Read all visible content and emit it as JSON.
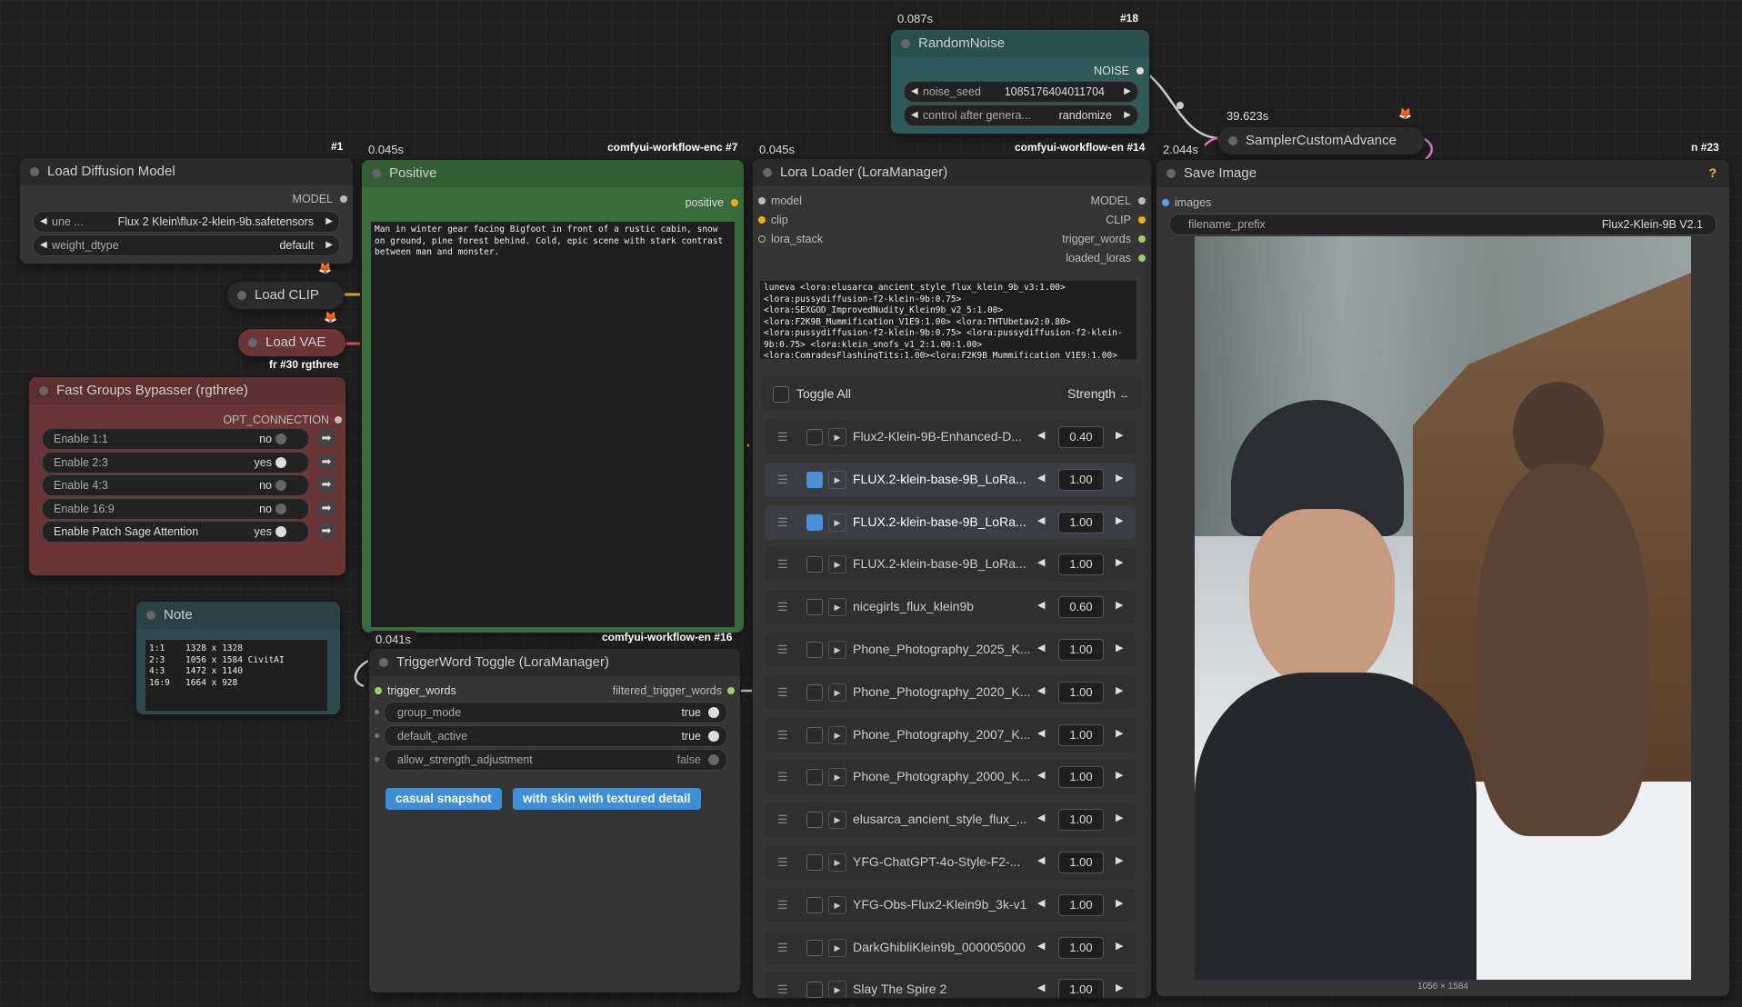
{
  "colors": {
    "positive_green": "#3a6b3a",
    "noise_teal": "#2f5a5a",
    "vae_red": "#6b3535",
    "bypasser_red": "#6b3535",
    "note_teal": "#2f4a4f",
    "accent_blue": "#3c8fd8"
  },
  "timings": {
    "t_random": "0.087s",
    "t_positive": "0.045s",
    "t_lora": "0.045s",
    "t_sampler": "39.623s",
    "t_save": "2.044s",
    "t_trigger": "0.041s"
  },
  "ids": {
    "id_random": "#18",
    "id_load_diff": "#1",
    "id_positive": "comfyui-workflow-enc #7",
    "id_lora": "comfyui-workflow-en #14",
    "id_save": "#23",
    "id_bypasser": "#30 rgthree",
    "id_trigger": "comfyui-workflow-en #16"
  },
  "load_diffusion": {
    "title": "Load Diffusion Model",
    "out": "MODEL",
    "unet_prefix": "une ...",
    "unet_value": "Flux 2 Klein\\flux-2-klein-9b.safetensors",
    "dtype_label": "weight_dtype",
    "dtype_value": "default"
  },
  "load_clip": {
    "title": "Load CLIP"
  },
  "load_vae": {
    "title": "Load VAE"
  },
  "bypasser": {
    "title": "Fast Groups Bypasser (rgthree)",
    "out": "OPT_CONNECTION",
    "rows": [
      {
        "label": "Enable 1:1",
        "value": "no",
        "on": false
      },
      {
        "label": "Enable 2:3",
        "value": "yes",
        "on": true
      },
      {
        "label": "Enable 4:3",
        "value": "no",
        "on": false
      },
      {
        "label": "Enable 16:9",
        "value": "no",
        "on": false
      },
      {
        "label": "Enable Patch Sage Attention",
        "value": "yes",
        "on": true
      }
    ]
  },
  "note": {
    "title": "Note",
    "text": "1:1    1328 x 1328\n2:3    1056 x 1584 CivitAI\n4:3    1472 x 1140\n16:9   1664 x 928"
  },
  "positive": {
    "title": "Positive",
    "out": "positive",
    "prompt": "Man in winter gear facing Bigfoot in front of a rustic cabin, snow on ground, pine forest behind. Cold, epic scene with stark contrast between man and monster."
  },
  "random_noise": {
    "title": "RandomNoise",
    "out": "NOISE",
    "seed_label": "noise_seed",
    "seed_value": "1085176404011704",
    "ctrl_label": "control after genera...",
    "ctrl_value": "randomize"
  },
  "sampler": {
    "title": "SamplerCustomAdvance"
  },
  "lora_loader": {
    "title": "Lora Loader (LoraManager)",
    "in_model": "model",
    "in_clip": "clip",
    "in_stack": "lora_stack",
    "out_model": "MODEL",
    "out_clip": "CLIP",
    "out_trigger": "trigger_words",
    "out_loaded": "loaded_loras",
    "text": "luneva <lora:elusarca_ancient_style_flux_klein_9b_v3:1.00>\n<lora:pussydiffusion-f2-klein-9b:0.75>\n<lora:SEXGOD_ImprovedNudity_Klein9b_v2_5:1.00>\n<lora:F2K9B_Mummification_V1E9:1.00> <lora:THTUbetav2:0.80>\n<lora:pussydiffusion-f2-klein-9b:0.75> <lora:pussydiffusion-f2-klein-9b:0.75> <lora:klein_snofs_v1_2:1.00:1.00>\n<lora:ComradesFlashingTits:1.00><lora:F2K9B_Mummification_V1E9:1.00>",
    "toggle_all": "Toggle All",
    "strength_header": "Strength",
    "rows": [
      {
        "name": "Flux2-Klein-9B-Enhanced-D...",
        "strength": "0.40",
        "on": false,
        "active": false
      },
      {
        "name": "FLUX.2-klein-base-9B_LoRa...",
        "strength": "1.00",
        "on": true,
        "active": true
      },
      {
        "name": "FLUX.2-klein-base-9B_LoRa...",
        "strength": "1.00",
        "on": true,
        "active": true
      },
      {
        "name": "FLUX.2-klein-base-9B_LoRa...",
        "strength": "1.00",
        "on": false,
        "active": false
      },
      {
        "name": "nicegirls_flux_klein9b",
        "strength": "0.60",
        "on": false,
        "active": false
      },
      {
        "name": "Phone_Photography_2025_K...",
        "strength": "1.00",
        "on": false,
        "active": false
      },
      {
        "name": "Phone_Photography_2020_K...",
        "strength": "1.00",
        "on": false,
        "active": false
      },
      {
        "name": "Phone_Photography_2007_K...",
        "strength": "1.00",
        "on": false,
        "active": false
      },
      {
        "name": "Phone_Photography_2000_K...",
        "strength": "1.00",
        "on": false,
        "active": false
      },
      {
        "name": "elusarca_ancient_style_flux_...",
        "strength": "1.00",
        "on": false,
        "active": false
      },
      {
        "name": "YFG-ChatGPT-4o-Style-F2-...",
        "strength": "1.00",
        "on": false,
        "active": false
      },
      {
        "name": "YFG-Obs-Flux2-Klein9b_3k-v1",
        "strength": "1.00",
        "on": false,
        "active": false
      },
      {
        "name": "DarkGhibliKlein9b_000005000",
        "strength": "1.00",
        "on": false,
        "active": false
      },
      {
        "name": "Slay The Spire 2",
        "strength": "1.00",
        "on": false,
        "active": false
      }
    ]
  },
  "trigger_toggle": {
    "title": "TriggerWord Toggle (LoraManager)",
    "in": "trigger_words",
    "out": "filtered_trigger_words",
    "widgets": [
      {
        "label": "group_mode",
        "value": "true",
        "on": true
      },
      {
        "label": "default_active",
        "value": "true",
        "on": true
      },
      {
        "label": "allow_strength_adjustment",
        "value": "false",
        "on": false
      }
    ],
    "chips": [
      "casual snapshot",
      "with skin with textured detail"
    ]
  },
  "save_image": {
    "title": "Save Image",
    "help": "?",
    "in": "images",
    "prefix_label": "filename_prefix",
    "prefix_value": "Flux2-Klein-9B V2.1",
    "dims": "1056 × 1584"
  }
}
